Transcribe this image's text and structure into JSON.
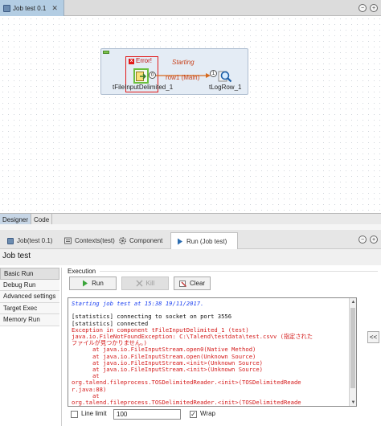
{
  "editor": {
    "tab_title": "Job test 0.1",
    "tab_close": "✕",
    "minimize": "−",
    "maximize": "+"
  },
  "canvas": {
    "error_label": "Error!",
    "trigger_label": "Starting",
    "row_label": "row1 (Main)",
    "input_port": "0",
    "log_port": "1",
    "input_component": "tFileInputDelimited_1",
    "log_component": "tLogRow_1"
  },
  "view_tabs": [
    "Designer",
    "Code"
  ],
  "panel_tabs": {
    "job": "Job(test 0.1)",
    "contexts": "Contexts(test)",
    "component": "Component",
    "run": "Run (Job test)"
  },
  "panel": {
    "title": "Job test",
    "side_menu": [
      "Basic Run",
      "Debug Run",
      "Advanced settings",
      "Target Exec",
      "Memory Run"
    ],
    "execution_label": "Execution",
    "run_button": "Run",
    "kill_button": "Kill",
    "clear_button": "Clear",
    "expand_button": "<<",
    "line_limit_label": "Line limit",
    "line_limit_value": "100",
    "wrap_label": "Wrap"
  },
  "console": {
    "lines": [
      {
        "style": "italic",
        "text": "Starting job test at 15:38 19/11/2017."
      },
      {
        "style": "normal",
        "text": ""
      },
      {
        "style": "normal",
        "text": "[statistics] connecting to socket on port 3556"
      },
      {
        "style": "normal",
        "text": "[statistics] connected"
      },
      {
        "style": "error",
        "text": "Exception in component tFileInputDelimited_1 (test)"
      },
      {
        "style": "error",
        "text": "java.io.FileNotFoundException: C:\\Talend\\testdata\\test.csvv (指定された"
      },
      {
        "style": "error",
        "text": "ファイルが見つかりません。)"
      },
      {
        "style": "error",
        "text": "      at java.io.FileInputStream.open0(Native Method)"
      },
      {
        "style": "error",
        "text": "      at java.io.FileInputStream.open(Unknown Source)"
      },
      {
        "style": "error",
        "text": "      at java.io.FileInputStream.<init>(Unknown Source)"
      },
      {
        "style": "error",
        "text": "      at java.io.FileInputStream.<init>(Unknown Source)"
      },
      {
        "style": "error",
        "text": "      at"
      },
      {
        "style": "error",
        "text": "org.talend.fileprocess.TOSDelimitedReader.<init>(TOSDelimitedReade"
      },
      {
        "style": "error",
        "text": "r.java:88)"
      },
      {
        "style": "error",
        "text": "      at"
      },
      {
        "style": "error",
        "text": "org.talend.fileprocess.TOSDelimitedReader.<init>(TOSDelimitedReade"
      }
    ]
  }
}
